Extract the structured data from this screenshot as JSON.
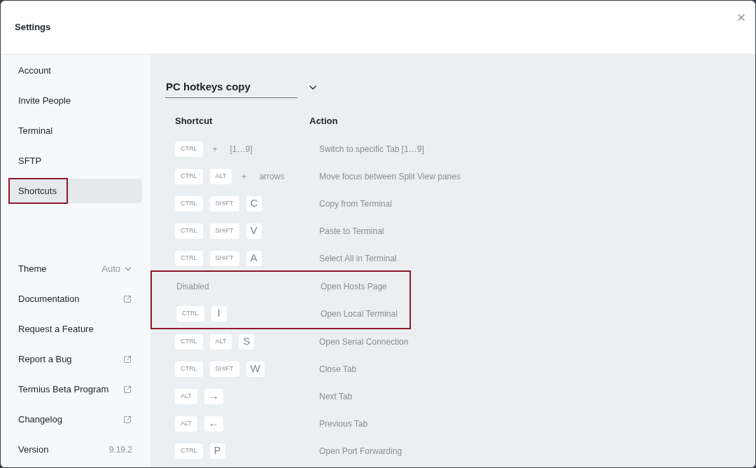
{
  "window": {
    "title": "Settings"
  },
  "sidebar": {
    "items": [
      {
        "label": "Account",
        "selected": false,
        "highlighted": false
      },
      {
        "label": "Invite People",
        "selected": false,
        "highlighted": false
      },
      {
        "label": "Terminal",
        "selected": false,
        "highlighted": false
      },
      {
        "label": "SFTP",
        "selected": false,
        "highlighted": false
      },
      {
        "label": "Shortcuts",
        "selected": true,
        "highlighted": true
      }
    ],
    "bottom_items": [
      {
        "kind": "select",
        "label": "Theme",
        "value": "Auto"
      },
      {
        "kind": "link",
        "label": "Documentation",
        "external": true
      },
      {
        "kind": "link",
        "label": "Request a Feature",
        "external": false
      },
      {
        "kind": "link",
        "label": "Report a Bug",
        "external": true
      },
      {
        "kind": "link",
        "label": "Termius Beta Program",
        "external": true
      },
      {
        "kind": "link",
        "label": "Changelog",
        "external": true
      },
      {
        "kind": "info",
        "label": "Version",
        "value": "9.19.2"
      }
    ]
  },
  "keymap_select": {
    "value": "PC hotkeys copy"
  },
  "table": {
    "columns": [
      "Shortcut",
      "Action"
    ],
    "rows": [
      {
        "highlighted": false,
        "action": "Switch to specific Tab [1…9]",
        "keys": [
          {
            "kind": "mod",
            "label": "CTRL"
          },
          {
            "kind": "text",
            "label": "+"
          },
          {
            "kind": "text",
            "label": "[1…9]"
          }
        ]
      },
      {
        "highlighted": false,
        "action": "Move focus between Split View panes",
        "keys": [
          {
            "kind": "mod",
            "label": "CTRL"
          },
          {
            "kind": "mod",
            "label": "ALT"
          },
          {
            "kind": "text",
            "label": "+"
          },
          {
            "kind": "text",
            "label": "arrows"
          }
        ]
      },
      {
        "highlighted": false,
        "action": "Copy from Terminal",
        "keys": [
          {
            "kind": "mod",
            "label": "CTRL"
          },
          {
            "kind": "mod",
            "label": "SHIFT"
          },
          {
            "kind": "key",
            "label": "C"
          }
        ]
      },
      {
        "highlighted": false,
        "action": "Paste to Terminal",
        "keys": [
          {
            "kind": "mod",
            "label": "CTRL"
          },
          {
            "kind": "mod",
            "label": "SHIFT"
          },
          {
            "kind": "key",
            "label": "V"
          }
        ]
      },
      {
        "highlighted": false,
        "action": "Select All in Terminal",
        "keys": [
          {
            "kind": "mod",
            "label": "CTRL"
          },
          {
            "kind": "mod",
            "label": "SHIFT"
          },
          {
            "kind": "key",
            "label": "A"
          }
        ]
      },
      {
        "highlighted": true,
        "action": "Open Hosts Page",
        "keys": [
          {
            "kind": "disabled",
            "label": "Disabled"
          }
        ]
      },
      {
        "highlighted": true,
        "action": "Open Local Terminal",
        "keys": [
          {
            "kind": "mod",
            "label": "CTRL"
          },
          {
            "kind": "key",
            "label": "I"
          }
        ]
      },
      {
        "highlighted": false,
        "action": "Open Serial Connection",
        "keys": [
          {
            "kind": "mod",
            "label": "CTRL"
          },
          {
            "kind": "mod",
            "label": "ALT"
          },
          {
            "kind": "key",
            "label": "S"
          }
        ]
      },
      {
        "highlighted": false,
        "action": "Close Tab",
        "keys": [
          {
            "kind": "mod",
            "label": "CTRL"
          },
          {
            "kind": "mod",
            "label": "SHIFT"
          },
          {
            "kind": "key",
            "label": "W"
          }
        ]
      },
      {
        "highlighted": false,
        "action": "Next Tab",
        "keys": [
          {
            "kind": "mod",
            "label": "ALT"
          },
          {
            "kind": "key",
            "label": "→"
          }
        ]
      },
      {
        "highlighted": false,
        "action": "Previous Tab",
        "keys": [
          {
            "kind": "mod",
            "label": "ALT"
          },
          {
            "kind": "key",
            "label": "←"
          }
        ]
      },
      {
        "highlighted": false,
        "action": "Open Port Forwarding",
        "keys": [
          {
            "kind": "mod",
            "label": "CTRL"
          },
          {
            "kind": "key",
            "label": "P"
          }
        ]
      }
    ]
  }
}
